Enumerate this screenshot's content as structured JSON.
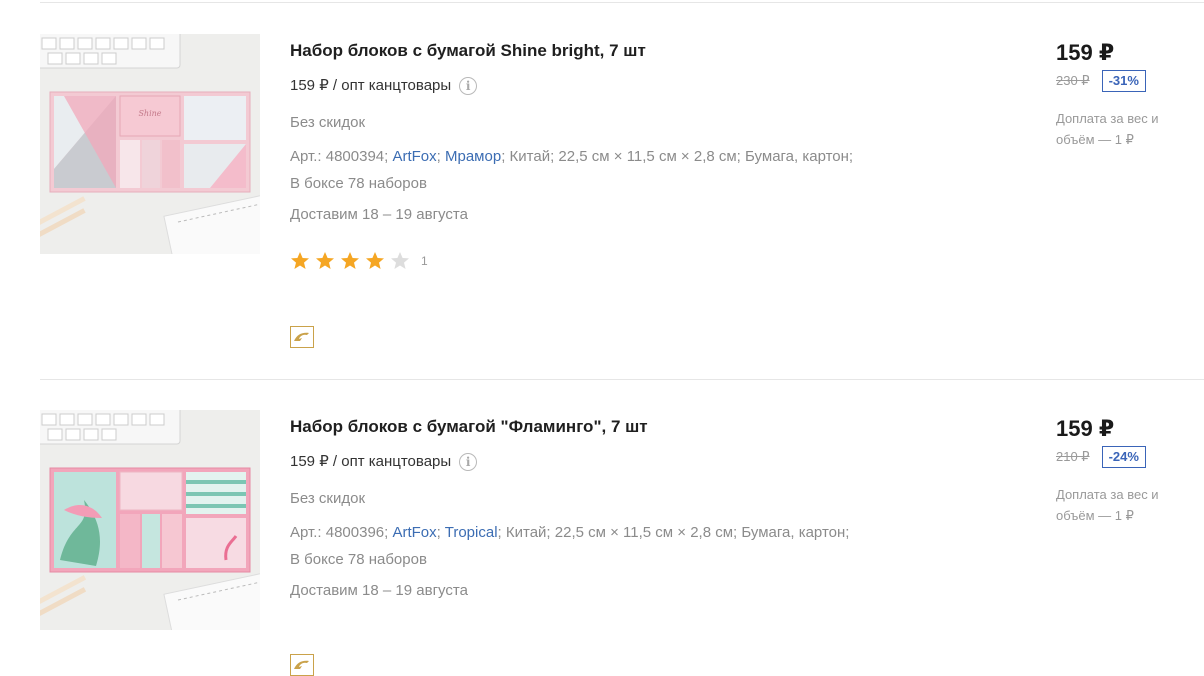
{
  "products": [
    {
      "title": "Набор блоков с бумагой Shine bright, 7 шт",
      "wholesale_text": "159 ₽ / опт канцтовары",
      "no_discount": "Без скидок",
      "art": "Арт.: 4800394;",
      "brand": "ArtFox",
      "series": "Мрамор",
      "country": "Китай;",
      "size": "22,5 см × 11,5 см × 2,8 см;",
      "material": "Бумага, картон;",
      "box": "В боксе 78 наборов",
      "delivery": "Доставим 18 – 19 августа",
      "rating": 4,
      "rating_count": "1",
      "price": "159 ₽",
      "old_price": "230 ₽",
      "discount": "-31%",
      "surcharge": "Доплата за вес и объём — 1 ₽",
      "image_desc": "Pink marble sticky-note set on desk with keyboard"
    },
    {
      "title": "Набор блоков с бумагой \"Фламинго\", 7 шт",
      "wholesale_text": "159 ₽ / опт канцтовары",
      "no_discount": "Без скидок",
      "art": "Арт.: 4800396;",
      "brand": "ArtFox",
      "series": "Tropical",
      "country": "Китай;",
      "size": "22,5 см × 11,5 см × 2,8 см;",
      "material": "Бумага, картон;",
      "box": "В боксе 78 наборов",
      "delivery": "Доставим 18 – 19 августа",
      "price": "159 ₽",
      "old_price": "210 ₽",
      "discount": "-24%",
      "surcharge": "Доплата за вес и объём — 1 ₽",
      "image_desc": "Tropical flamingo sticky-note set on desk with keyboard"
    }
  ],
  "colors": {
    "accent": "#3c6db3",
    "star": "#f5a623",
    "star_empty": "#dddddd",
    "promo": "#caa24a"
  },
  "icons": {
    "info": "info-icon",
    "star": "star-icon",
    "promo": "dolphin-promo-icon"
  }
}
